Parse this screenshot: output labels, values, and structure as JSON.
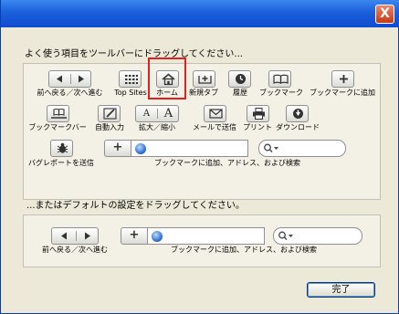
{
  "window": {
    "close_label": "X"
  },
  "instruction_top": "よく使う項目をツールバーにドラッグしてください...",
  "instruction_bottom": "...またはデフォルトの設定をドラッグしてください。",
  "toolbar_items": {
    "back_forward": "前へ戻る／次へ進む",
    "top_sites": "Top Sites",
    "home": "ホーム",
    "new_tab": "新規タブ",
    "history": "履歴",
    "bookmarks": "ブックマーク",
    "add_bookmark": "ブックマークに追加",
    "bookmarks_bar": "ブックマークバー",
    "autofill": "自動入力",
    "zoom": "拡大／縮小",
    "mail": "メールで送信",
    "print": "プリント",
    "download": "ダウンロード",
    "bug_report": "バグレポートを送信",
    "address_search": "ブックマークに追加、アドレス、および検索",
    "font_small": "A",
    "font_large": "A",
    "add_symbol": "+"
  },
  "default_set": {
    "back_forward": "前へ戻る／次へ進む",
    "address_search": "ブックマークに追加、アドレス、および検索",
    "add_symbol": "+"
  },
  "done_button": "完了",
  "colors": {
    "title_bar": "#1b5fdc",
    "highlight": "#e02020",
    "dialog_bg": "#ece9d8"
  }
}
